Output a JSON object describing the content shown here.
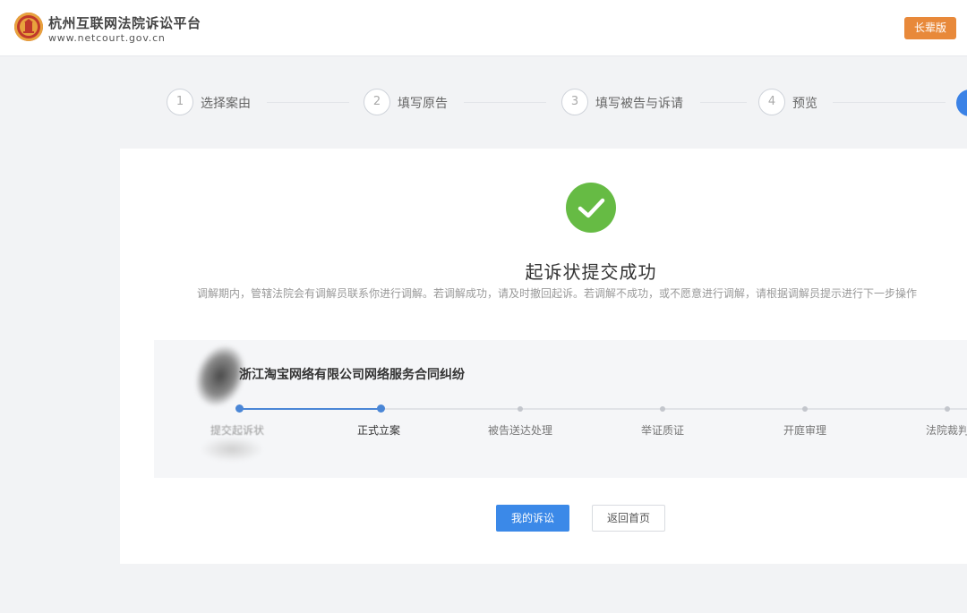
{
  "header": {
    "site_name": "杭州互联网法院诉讼平台",
    "site_url": "www.netcourt.gov.cn",
    "version_button": "长辈版",
    "logo_icon": "court-emblem-icon"
  },
  "steps": [
    {
      "num": "1",
      "label": "选择案由"
    },
    {
      "num": "2",
      "label": "填写原告"
    },
    {
      "num": "3",
      "label": "填写被告与诉请"
    },
    {
      "num": "4",
      "label": "预览"
    }
  ],
  "result": {
    "icon": "check-circle-icon",
    "title": "起诉状提交成功",
    "description": "调解期内，管辖法院会有调解员联系你进行调解。若调解成功，请及时撤回起诉。若调解不成功，或不愿意进行调解，请根据调解员提示进行下一步操作"
  },
  "case": {
    "title": "浙江淘宝网络有限公司网络服务合同纠纷",
    "stages": [
      "提交起诉状",
      "正式立案",
      "被告送达处理",
      "举证质证",
      "开庭审理",
      "法院裁判"
    ],
    "current_stage_index": 1
  },
  "actions": {
    "my_litigation": "我的诉讼",
    "back_home": "返回首页"
  },
  "colors": {
    "accent": "#3b89e8",
    "success": "#66bb44",
    "version_button": "#e8893a"
  }
}
